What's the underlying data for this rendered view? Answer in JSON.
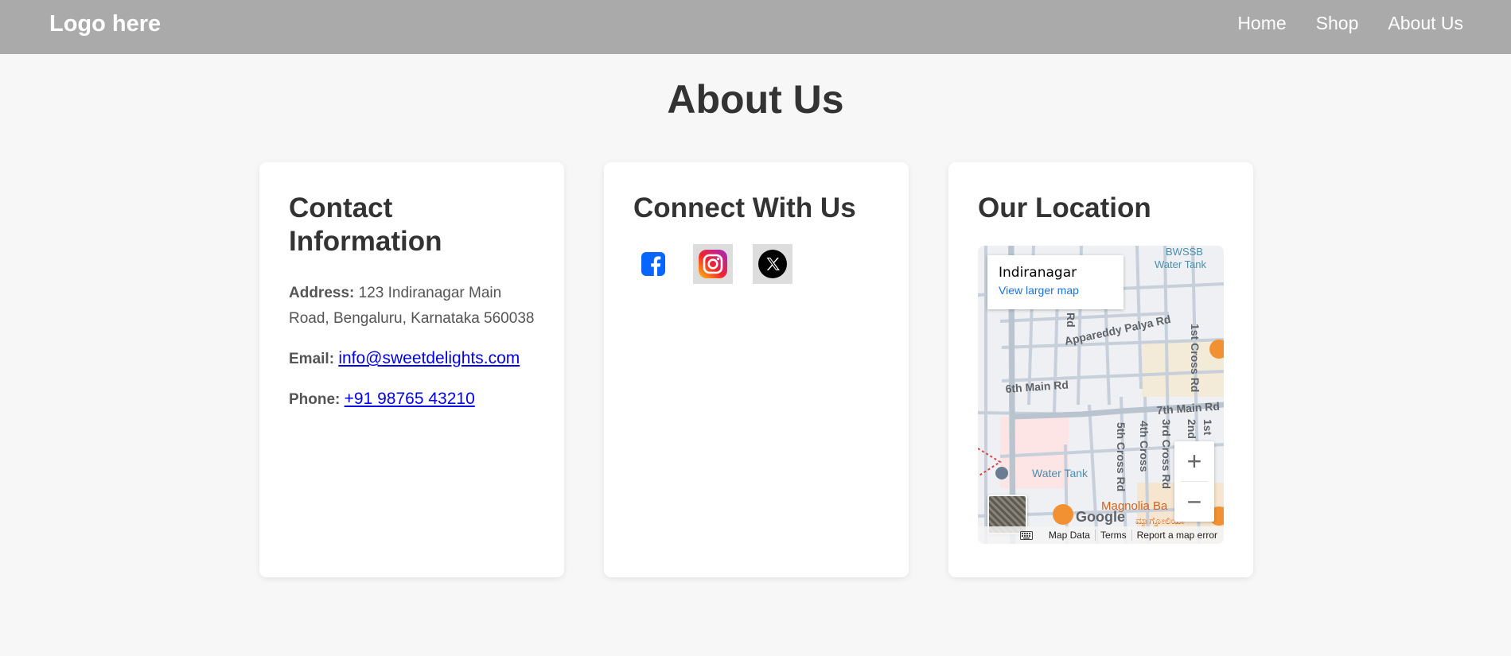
{
  "nav": {
    "logo": "Logo here",
    "links": [
      "Home",
      "Shop",
      "About Us"
    ]
  },
  "page": {
    "title": "About Us"
  },
  "contact": {
    "heading_line1": "Contact",
    "heading_line2": "Information",
    "address_label": "Address:",
    "address_value": "123 Indiranagar Main Road, Bengaluru, Karnataka 560038",
    "email_label": "Email:",
    "email_value": "info@sweetdelights.com",
    "phone_label": "Phone:",
    "phone_value": "+91 98765 43210"
  },
  "connect": {
    "heading": "Connect With Us",
    "icons": [
      "facebook-icon",
      "instagram-icon",
      "x-icon"
    ]
  },
  "location": {
    "heading": "Our Location",
    "map": {
      "place_name": "Indiranagar",
      "larger_map": "View larger map",
      "labels": {
        "bwssb": "BWSSB",
        "water_tank_1": "Water Tank",
        "appareddy": "Appareddy Palya Rd",
        "main6": "6th Main Rd",
        "main7": "7th Main Rd",
        "cross1": "1st Cross Rd",
        "cross1b": "1st",
        "cross2": "2nd",
        "cross3": "3rd Cross Rd",
        "cross4": "4th Cross",
        "cross5": "5th Cross Rd",
        "rd": "Rd",
        "water_tank_2": "Water Tank",
        "magnolia": "Magnolia Ba",
        "kannada": "ಮ್ಯಾಗ್ನೋಲಿಯಾ",
        "google": "Google"
      },
      "zoom_in": "+",
      "zoom_out": "−",
      "attribution": [
        "Map Data",
        "Terms",
        "Report a map error"
      ]
    }
  }
}
